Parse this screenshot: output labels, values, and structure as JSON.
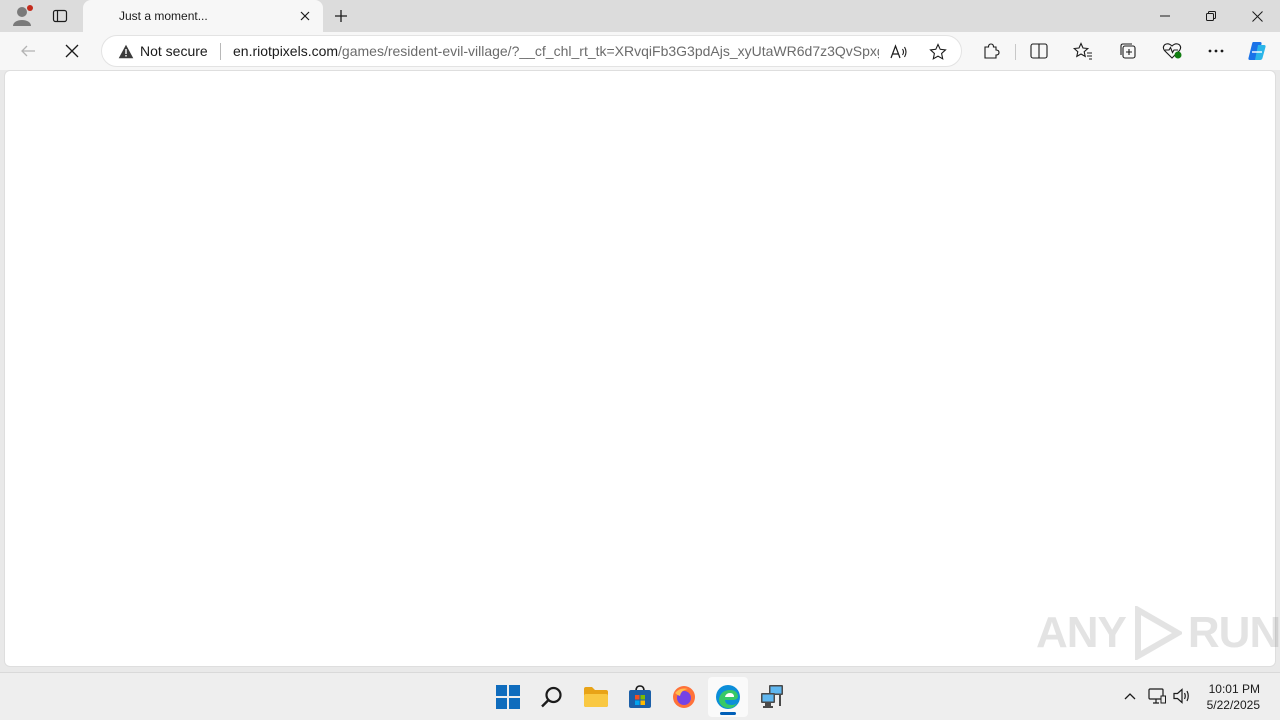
{
  "browser": {
    "tab": {
      "title": "Just a moment..."
    },
    "address_bar": {
      "security_label": "Not secure",
      "url_host": "en.riotpixels.com",
      "url_path": "/games/resident-evil-village/?__cf_chl_rt_tk=XRvqiFb3G3pdAjs_xyUtaWR6d7z3QvSpxgc..."
    },
    "loading": true
  },
  "watermark": {
    "text_left": "ANY",
    "text_right": "RUN"
  },
  "taskbar": {
    "apps": [
      "start",
      "search",
      "file-explorer",
      "microsoft-store",
      "firefox",
      "edge",
      "network-tool"
    ],
    "active_app": "edge"
  },
  "clock": {
    "time": "10:01 PM",
    "date": "5/22/2025"
  },
  "colors": {
    "accent": "#005fb8",
    "warning": "#c42b1c",
    "copilot_blue": "#1a73e8"
  }
}
